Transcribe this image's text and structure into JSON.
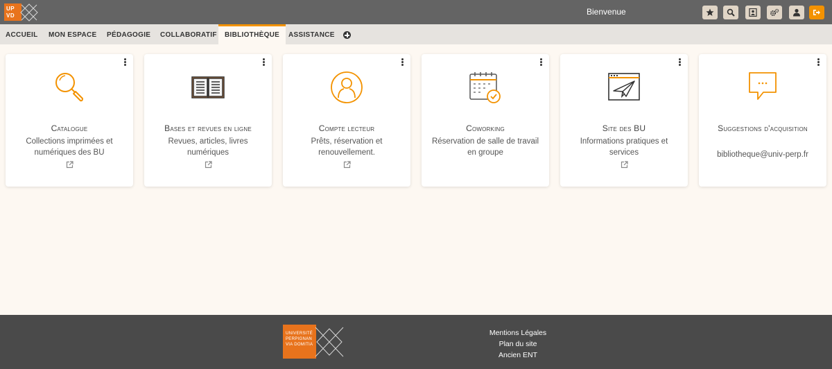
{
  "header": {
    "logo_text": "UP VD",
    "welcome": "Bienvenue",
    "buttons": [
      {
        "name": "favorites-button",
        "icon": "star-icon"
      },
      {
        "name": "search-button",
        "icon": "search-icon"
      },
      {
        "name": "directory-button",
        "icon": "contact-card-icon"
      },
      {
        "name": "settings-button",
        "icon": "cogs-icon"
      },
      {
        "name": "user-button",
        "icon": "user-icon"
      },
      {
        "name": "logout-button",
        "icon": "sign-out-icon"
      }
    ],
    "colors": {
      "bar": "#646464",
      "accent": "#f39200",
      "button_bg": "#e0d5c6"
    }
  },
  "nav": {
    "items": [
      {
        "label": "ACCUEIL"
      },
      {
        "label": "MON ESPACE"
      },
      {
        "label": "PÉDAGOGIE"
      },
      {
        "label": "COLLABORATIF"
      },
      {
        "label": "BIBLIOTHÈQUE",
        "active": true
      },
      {
        "label": "ASSISTANCE"
      }
    ],
    "add_icon": "plus-circle-icon"
  },
  "cards": [
    {
      "icon": "magnifier-icon",
      "title": "Catalogue",
      "desc": "Collections imprimées et numériques des BU",
      "external": true
    },
    {
      "icon": "open-book-icon",
      "title": "Bases et revues en ligne",
      "desc": "Revues, articles, livres numériques",
      "external": true
    },
    {
      "icon": "user-circle-icon",
      "title": "Compte lecteur",
      "desc": "Prêts, réservation et renouvellement.",
      "external": true
    },
    {
      "icon": "calendar-check-icon",
      "title": "Coworking",
      "desc": "Réservation de salle de travail en groupe",
      "external": false
    },
    {
      "icon": "paper-plane-window-icon",
      "title": "Site des BU",
      "desc": "Informations pratiques et services",
      "external": true
    },
    {
      "icon": "speech-bubble-icon",
      "title": "Suggestions d'acquisition",
      "desc": "bibliotheque@univ-perp.fr",
      "external": false
    }
  ],
  "footer": {
    "logo_text": "UNIVERSITÉ PERPIGNAN VIA DOMITIA",
    "links": [
      "Mentions Légales",
      "Plan du site",
      "Ancien ENT"
    ]
  }
}
